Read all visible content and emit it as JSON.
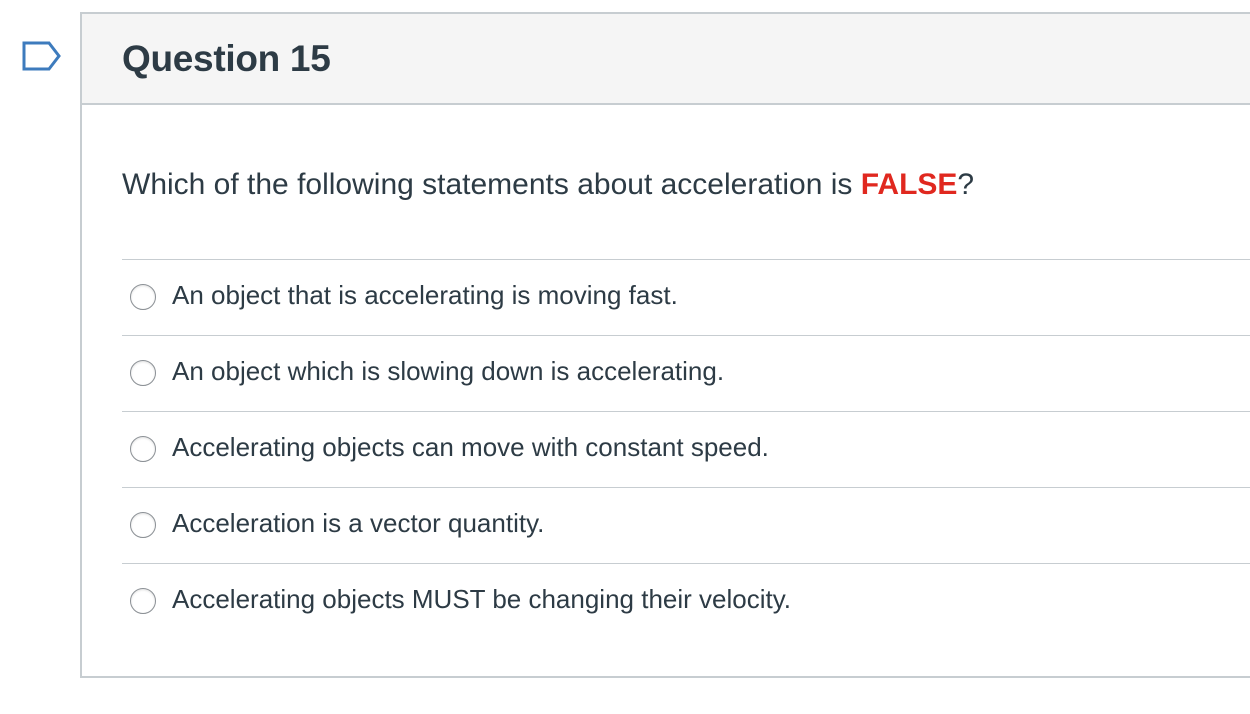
{
  "question": {
    "title": "Question 15",
    "prompt_before": "Which of the following statements about acceleration is ",
    "prompt_highlight": "FALSE",
    "prompt_after": "?",
    "highlight_color": "#e0281f"
  },
  "answers": [
    {
      "label": "An object that is accelerating is moving fast.",
      "selected": false
    },
    {
      "label": "An object which is slowing down is accelerating.",
      "selected": false
    },
    {
      "label": "Accelerating objects can move with constant speed.",
      "selected": false
    },
    {
      "label": "Acceleration is a vector quantity.",
      "selected": false
    },
    {
      "label": "Accelerating objects MUST be changing their velocity.",
      "selected": false
    }
  ],
  "icons": {
    "flag": "flag-question-icon"
  },
  "colors": {
    "text": "#2d3b45",
    "border": "#c7cdd1",
    "header_bg": "#f5f5f5",
    "flag": "#3d7bbd"
  }
}
